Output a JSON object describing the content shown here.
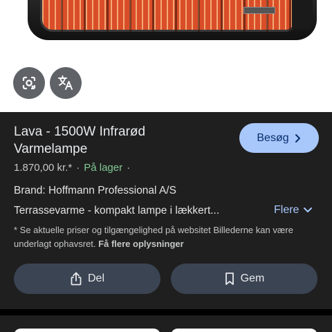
{
  "product": {
    "title": "Lava - 1500W Infrarød Varmelampe",
    "price": "1.870,00 kr.*",
    "separator": "·",
    "availability": "På lager",
    "trailing_separator": "·",
    "brand": "Brand: Hoffmann Professional A/S",
    "description": "Terrassevarme - kompakt lampe i lækkert...",
    "more_label": "Flere",
    "disclaimer": "* Se aktuelle priser og tilgængelighed på websitet Billederne kan være underlagt ophavsret.",
    "disclaimer_link": "Få flere oplysninger"
  },
  "buttons": {
    "visit_label": "Besøg",
    "share_label": "Del",
    "save_label": "Gem"
  },
  "icons": {
    "lens": "google-lens-icon",
    "translate": "translate-icon",
    "visit_chevron": "chevron-right-icon",
    "more_chevron": "chevron-down-icon",
    "share": "share-icon",
    "save": "bookmark-icon"
  },
  "colors": {
    "background": "#1f1f1f",
    "accent": "#a8c7fa",
    "in_stock": "#81c995",
    "action_button": "#3b4452"
  }
}
